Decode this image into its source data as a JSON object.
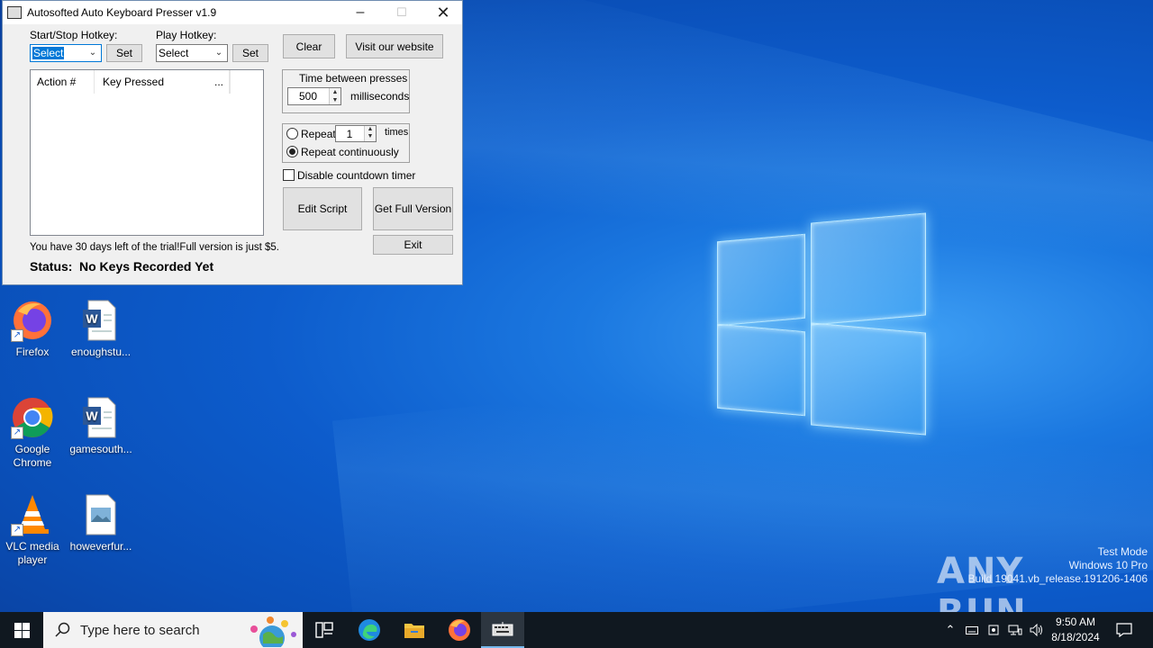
{
  "app": {
    "title": "Autosofted Auto Keyboard Presser v1.9",
    "start_stop_hotkey_label": "Start/Stop Hotkey:",
    "play_hotkey_label": "Play Hotkey:",
    "start_stop_value": "Select",
    "play_value": "Select",
    "set_label": "Set",
    "clear_label": "Clear",
    "website_label": "Visit our website",
    "columns": [
      "Action #",
      "Key Pressed",
      "..."
    ],
    "time_between_label": "Time between presses",
    "time_value": "500",
    "time_unit": "milliseconds",
    "repeat_label": "Repeat",
    "repeat_count": "1",
    "times_label": "times",
    "repeat_continuously_label": "Repeat continuously",
    "repeat_mode": "continuously",
    "disable_countdown_label": "Disable countdown timer",
    "disable_countdown_checked": false,
    "edit_script_label": "Edit Script",
    "full_version_label": "Get Full Version",
    "exit_label": "Exit",
    "trial_text": "You have 30 days left of the trial!Full version is just $5.",
    "status_label": "Status:",
    "status_value": "No Keys Recorded Yet"
  },
  "desktop": {
    "icons": [
      {
        "label": "Firefox",
        "icon": "firefox-icon"
      },
      {
        "label": "enoughstu...",
        "icon": "word-doc-icon"
      },
      {
        "label": "Google Chrome",
        "icon": "chrome-icon"
      },
      {
        "label": "gamesouth...",
        "icon": "word-doc-icon"
      },
      {
        "label": "VLC media player",
        "icon": "vlc-icon"
      },
      {
        "label": "howeverfur...",
        "icon": "image-file-icon"
      }
    ],
    "watermark": {
      "line1": "Test Mode",
      "line2": "Windows 10 Pro",
      "line3": "Build 19041.vb_release.191206-1406"
    },
    "brand": "ANY RUN"
  },
  "taskbar": {
    "search_placeholder": "Type here to search",
    "time": "9:50 AM",
    "date": "8/18/2024"
  },
  "colors": {
    "desktop_blue": "#0d5ccc",
    "accent": "#0078d7",
    "taskbar": "#101820"
  }
}
